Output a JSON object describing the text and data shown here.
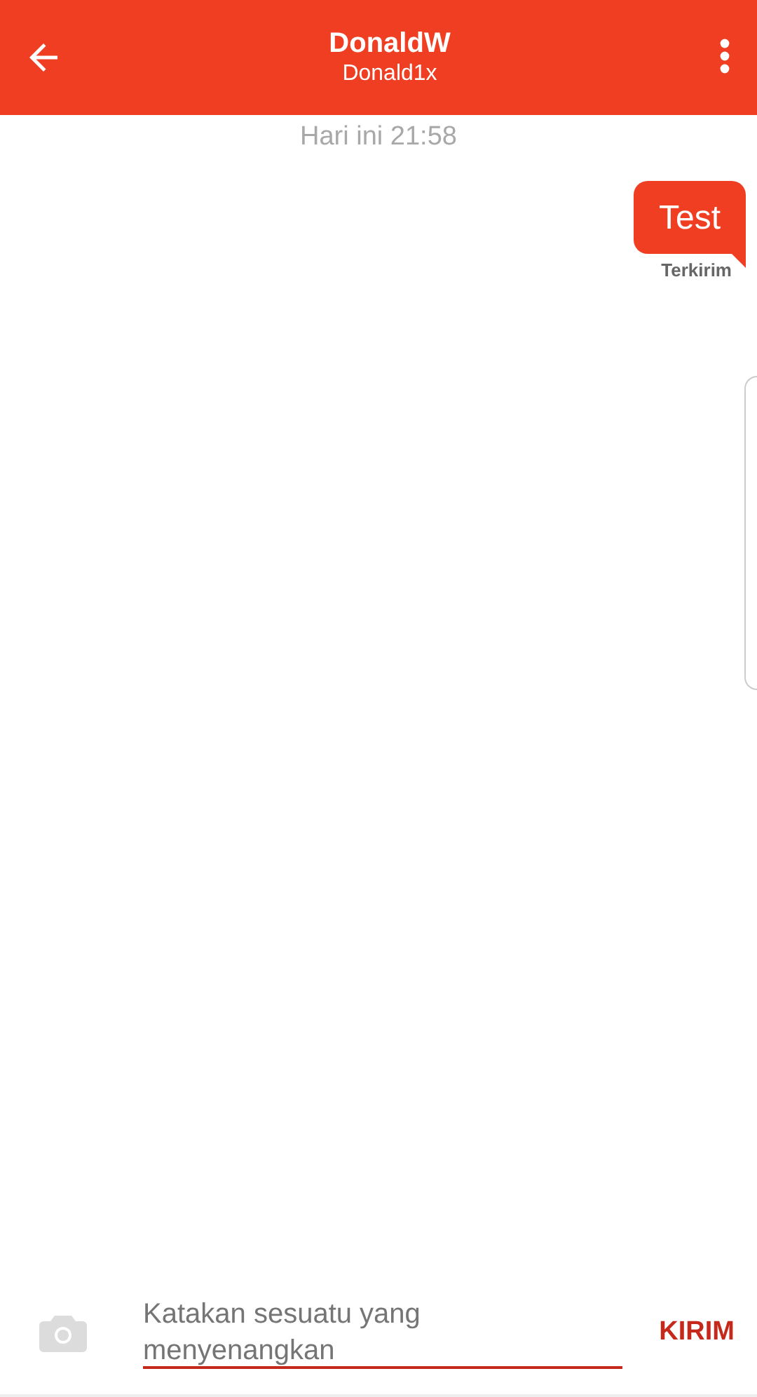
{
  "header": {
    "title": "DonaldW",
    "subtitle": "Donald1x"
  },
  "messages": [
    {
      "kind": "timestamp",
      "text": "Hari ini 21:58"
    },
    {
      "kind": "outgoing",
      "text": "Test",
      "status": "Terkirim"
    }
  ],
  "composer": {
    "placeholder": "Katakan sesuatu yang menyenangkan",
    "send": "KIRIM"
  }
}
